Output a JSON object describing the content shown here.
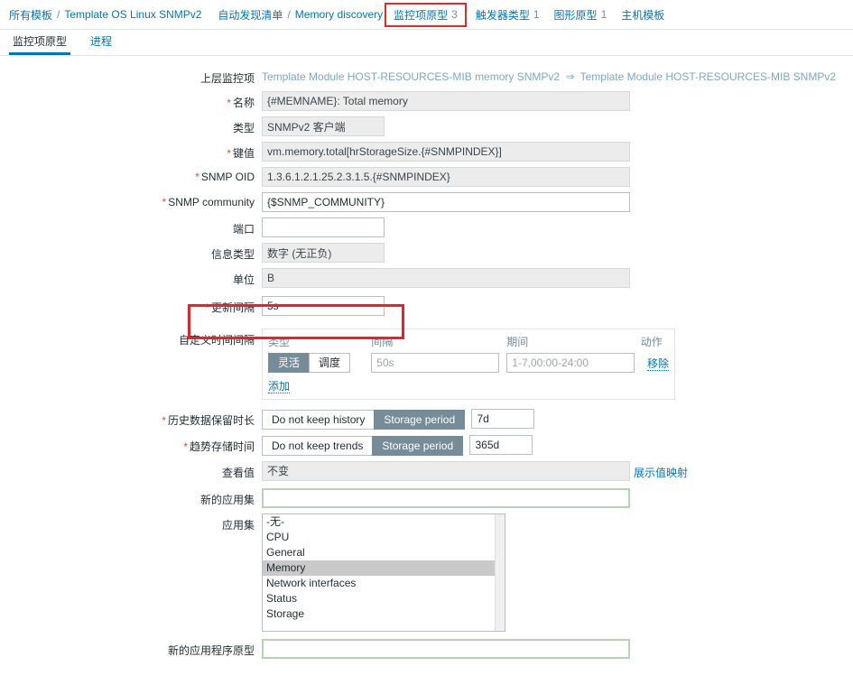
{
  "breadcrumb": {
    "group1": [
      {
        "label": "所有模板",
        "name": "crumb-all-templates"
      },
      {
        "label": "Template OS Linux SNMPv2",
        "name": "crumb-template"
      }
    ],
    "group2": [
      {
        "label": "自动发现清单",
        "name": "crumb-discovery-list"
      },
      {
        "label": "Memory discovery",
        "name": "crumb-memory-discovery"
      }
    ],
    "separator": "/",
    "tabs": [
      {
        "label": "监控项原型",
        "count": "3",
        "highlighted": true,
        "name": "crumb-tab-item-prototypes"
      },
      {
        "label": "触发器类型",
        "count": "1",
        "highlighted": false,
        "name": "crumb-tab-trigger-prototypes"
      },
      {
        "label": "图形原型",
        "count": "1",
        "highlighted": false,
        "name": "crumb-tab-graph-prototypes"
      },
      {
        "label": "主机模板",
        "count": "",
        "highlighted": false,
        "name": "crumb-tab-host-prototypes"
      }
    ]
  },
  "tabs": [
    {
      "label": "监控项原型",
      "active": true
    },
    {
      "label": "进程",
      "active": false
    }
  ],
  "form": {
    "parent_item": {
      "label": "上层监控项",
      "link1": "Template Module HOST-RESOURCES-MIB memory SNMPv2",
      "arrow": "⇒",
      "link2": "Template Module HOST-RESOURCES-MIB SNMPv2"
    },
    "name": {
      "label": "名称",
      "required": true,
      "value": "{#MEMNAME}: Total memory"
    },
    "type": {
      "label": "类型",
      "required": false,
      "value": "SNMPv2 客户端"
    },
    "key": {
      "label": "键值",
      "required": true,
      "value": "vm.memory.total[hrStorageSize.{#SNMPINDEX}]"
    },
    "snmp_oid": {
      "label": "SNMP OID",
      "required": true,
      "value": "1.3.6.1.2.1.25.2.3.1.5.{#SNMPINDEX}"
    },
    "snmp_community": {
      "label": "SNMP community",
      "required": true,
      "value": "{$SNMP_COMMUNITY}"
    },
    "port": {
      "label": "端口",
      "required": false,
      "value": ""
    },
    "value_type": {
      "label": "信息类型",
      "required": false,
      "value": "数字 (无正负)"
    },
    "units": {
      "label": "单位",
      "required": false,
      "value": "B"
    },
    "update_interval": {
      "label": "更新间隔",
      "required": true,
      "value": "5s",
      "highlighted": true
    },
    "custom_intervals": {
      "label": "自定义时间间隔",
      "headers": [
        "类型",
        "间隔",
        "期间",
        "动作"
      ],
      "rows": [
        {
          "type_options": [
            {
              "label": "灵活",
              "active": true
            },
            {
              "label": "调度",
              "active": false
            }
          ],
          "interval_value": "",
          "interval_placeholder": "50s",
          "period_value": "",
          "period_placeholder": "1-7,00:00-24:00",
          "action_label": "移除"
        }
      ],
      "add_label": "添加"
    },
    "history": {
      "label": "历史数据保留时长",
      "required": true,
      "options": [
        {
          "label": "Do not keep history",
          "active": false
        },
        {
          "label": "Storage period",
          "active": true
        }
      ],
      "value": "7d"
    },
    "trends": {
      "label": "趋势存储时间",
      "required": true,
      "options": [
        {
          "label": "Do not keep trends",
          "active": false
        },
        {
          "label": "Storage period",
          "active": true
        }
      ],
      "value": "365d"
    },
    "show_value": {
      "label": "查看值",
      "value": "不变",
      "link_label": "展示值映射"
    },
    "new_application": {
      "label": "新的应用集",
      "value": ""
    },
    "applications": {
      "label": "应用集",
      "options": [
        {
          "label": "-无-",
          "selected": false
        },
        {
          "label": "CPU",
          "selected": false
        },
        {
          "label": "General",
          "selected": false
        },
        {
          "label": "Memory",
          "selected": true
        },
        {
          "label": "Network interfaces",
          "selected": false
        },
        {
          "label": "Status",
          "selected": false
        },
        {
          "label": "Storage",
          "selected": false
        }
      ]
    },
    "new_application_prototype": {
      "label": "新的应用程序原型",
      "value": ""
    }
  },
  "colors": {
    "accent": "#0275b8",
    "annotation": "#e8212a",
    "segment_active": "#768d99",
    "readonly_bg": "#ececec"
  }
}
